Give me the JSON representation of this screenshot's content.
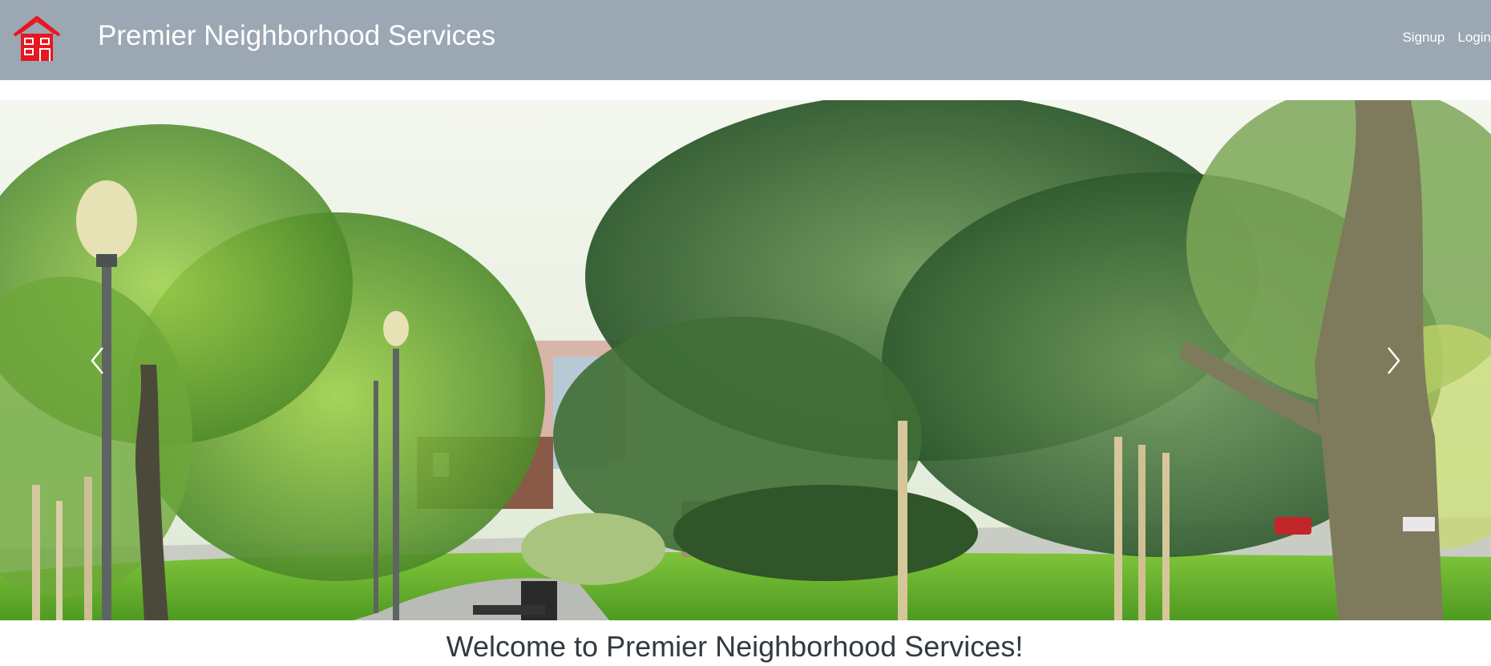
{
  "header": {
    "brand_title": "Premier Neighborhood Services",
    "logo_icon": "house-icon",
    "nav": {
      "signup_label": "Signup",
      "login_label": "Login"
    }
  },
  "carousel": {
    "prev_icon": "chevron-left-icon",
    "next_icon": "chevron-right-icon",
    "slide_image": "park-with-trees-and-lampposts"
  },
  "main": {
    "welcome_heading": "Welcome to Premier Neighborhood Services!"
  },
  "colors": {
    "navbar_bg": "#9ba7b2",
    "logo_red": "#e8161f",
    "heading_text": "#333a3f"
  }
}
